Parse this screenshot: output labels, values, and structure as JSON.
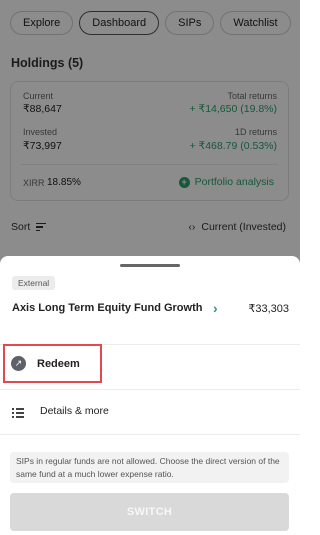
{
  "tabs": [
    {
      "label": "Explore",
      "active": false
    },
    {
      "label": "Dashboard",
      "active": true
    },
    {
      "label": "SIPs",
      "active": false
    },
    {
      "label": "Watchlist",
      "active": false
    }
  ],
  "holdings": {
    "title": "Holdings (5)",
    "current_label": "Current",
    "current_value": "₹88,647",
    "total_returns_label": "Total returns",
    "total_returns_value": "+ ₹14,650 (19.8%)",
    "invested_label": "Invested",
    "invested_value": "₹73,997",
    "one_day_returns_label": "1D returns",
    "one_day_returns_value": "+ ₹468.79 (0.53%)",
    "xirr_label": "XIRR",
    "xirr_value": "18.85%",
    "portfolio_analysis_label": "Portfolio analysis"
  },
  "sort": {
    "label": "Sort",
    "sort_by_label": "Current (Invested)"
  },
  "sheet": {
    "badge": "External",
    "fund_name": "Axis Long Term Equity Fund Growth",
    "fund_amount": "₹33,303",
    "redeem_label": "Redeem",
    "details_label": "Details & more",
    "info_text": "SIPs in regular funds are not allowed. Choose the direct version of the same fund at a much lower expense ratio.",
    "switch_label": "SWITCH"
  },
  "colors": {
    "accent_green": "#2aa06d",
    "highlight_red": "#e0494d",
    "overlay": "rgba(0,0,0,0.45)",
    "disabled_button": "#d9d9d9"
  },
  "icons": {
    "sort": "sort-lines-icon",
    "portfolio_analysis": "plus-circle-icon",
    "sort_by": "swap-horizontal-icon",
    "fund_chevron": "chevron-right-icon",
    "redeem": "arrow-up-right-icon",
    "details": "list-icon"
  }
}
